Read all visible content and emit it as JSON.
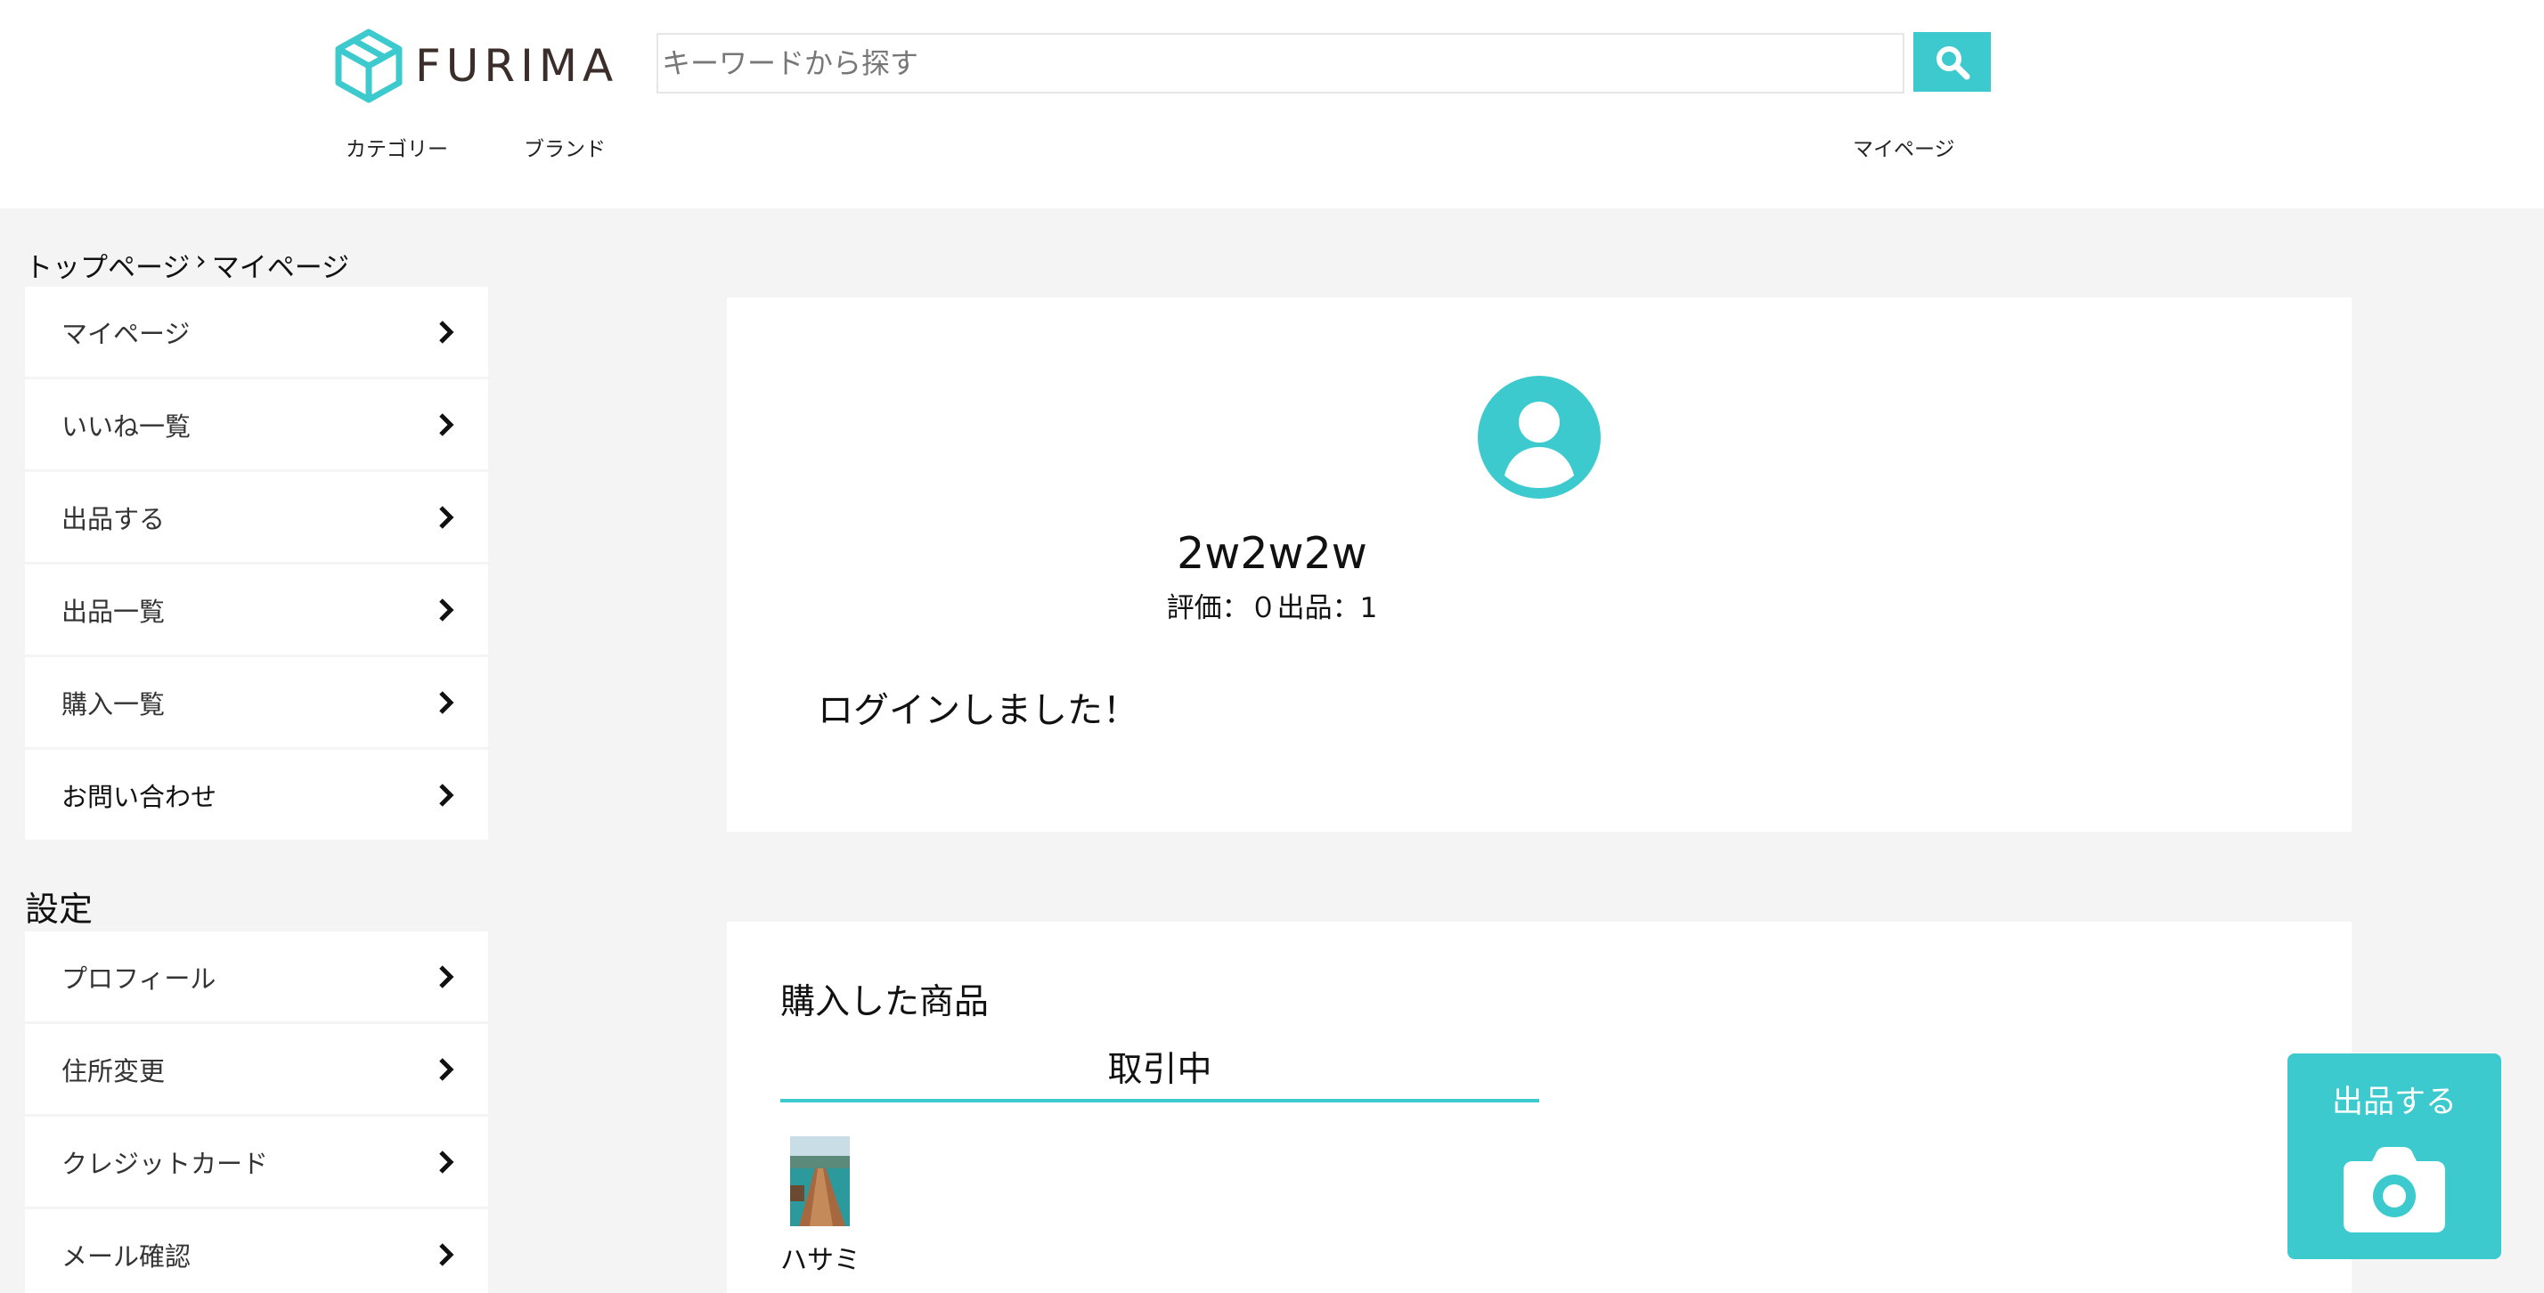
{
  "header": {
    "logo_text": "FURIMA",
    "search_placeholder": "キーワードから探す",
    "nav": {
      "category": "カテゴリー",
      "brand": "ブランド",
      "mypage": "マイページ"
    }
  },
  "breadcrumb": {
    "top": "トップページ",
    "separator": "›",
    "current": "マイページ"
  },
  "sidebar": {
    "items": [
      {
        "label": "マイページ"
      },
      {
        "label": "いいね一覧"
      },
      {
        "label": "出品する"
      },
      {
        "label": "出品一覧"
      },
      {
        "label": "購入一覧"
      },
      {
        "label": "お問い合わせ"
      }
    ],
    "settings_heading": "設定",
    "settings_items": [
      {
        "label": "プロフィール"
      },
      {
        "label": "住所変更"
      },
      {
        "label": "クレジットカード"
      },
      {
        "label": "メール確認"
      }
    ]
  },
  "profile": {
    "username": "2w2w2w",
    "stats": "評価：０出品：1",
    "flash_message": "ログインしました！"
  },
  "purchased": {
    "title": "購入した商品",
    "tab_label": "取引中",
    "items": [
      {
        "name": "ハサミ"
      }
    ]
  },
  "sell_fab": {
    "label": "出品する"
  },
  "colors": {
    "accent": "#3ccace",
    "background": "#f4f4f4",
    "card": "#ffffff"
  }
}
